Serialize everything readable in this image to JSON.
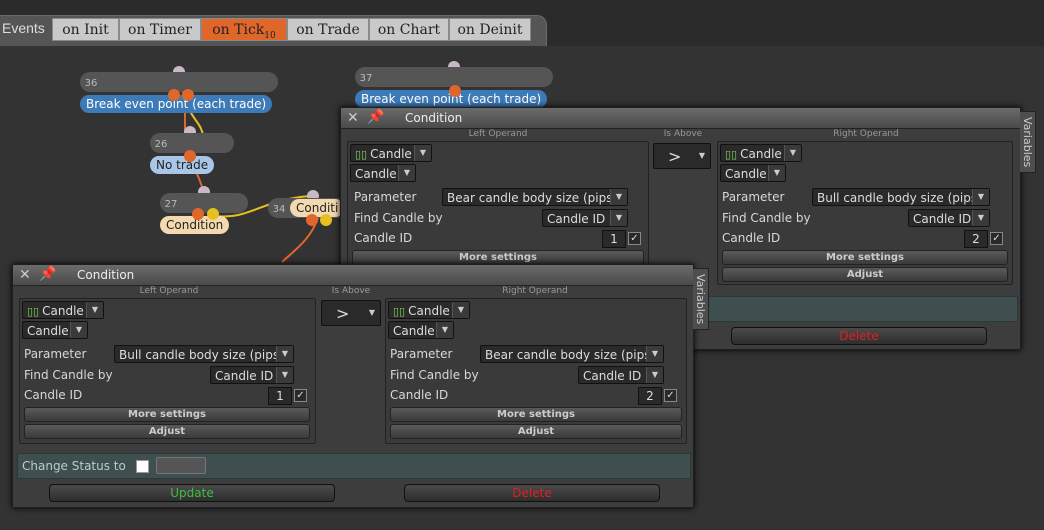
{
  "events_label": "Events",
  "tabs": [
    {
      "label": "on Init"
    },
    {
      "label": "on Timer"
    },
    {
      "label": "on Tick",
      "badge": "10"
    },
    {
      "label": "on Trade"
    },
    {
      "label": "on Chart"
    },
    {
      "label": "on Deinit"
    }
  ],
  "nodes": [
    {
      "num": "36",
      "label": "Break even point (each trade)"
    },
    {
      "num": "37",
      "label": "Break even point (each trade)"
    },
    {
      "num": "26",
      "label": "No trade"
    },
    {
      "num": "27",
      "label": "Condition"
    },
    {
      "num": "34",
      "label": "Conditi"
    }
  ],
  "panel_back": {
    "title": "Condition",
    "variables": "Variables",
    "left_header": "Left Operand",
    "mid_header": "Is Above",
    "right_header": "Right Operand",
    "operator": ">",
    "left": {
      "type": "Candle",
      "sub": "Candle",
      "parameter_label": "Parameter",
      "parameter": "Bear candle body size (pips)",
      "find_label": "Find Candle by",
      "find": "Candle ID",
      "id_label": "Candle ID",
      "id": "1",
      "more": "More settings"
    },
    "right": {
      "type": "Candle",
      "sub": "Candle",
      "parameter_label": "Parameter",
      "parameter": "Bull candle body size (pips)",
      "find_label": "Find Candle by",
      "find": "Candle ID",
      "id_label": "Candle ID",
      "id": "2",
      "more": "More settings",
      "adjust": "Adjust"
    },
    "delete": "Delete"
  },
  "panel_front": {
    "title": "Condition",
    "variables": "Variables",
    "left_header": "Left Operand",
    "mid_header": "Is Above",
    "right_header": "Right Operand",
    "operator": ">",
    "left": {
      "type": "Candle",
      "sub": "Candle",
      "parameter_label": "Parameter",
      "parameter": "Bull candle body size (pips)",
      "find_label": "Find Candle by",
      "find": "Candle ID",
      "id_label": "Candle ID",
      "id": "1",
      "more": "More settings",
      "adjust": "Adjust"
    },
    "right": {
      "type": "Candle",
      "sub": "Candle",
      "parameter_label": "Parameter",
      "parameter": "Bear candle body size (pips)",
      "find_label": "Find Candle by",
      "find": "Candle ID",
      "id_label": "Candle ID",
      "id": "2",
      "more": "More settings",
      "adjust": "Adjust"
    },
    "status_label": "Change Status to",
    "update": "Update",
    "delete": "Delete"
  },
  "colors": {
    "active_tab": "#e0662a",
    "update": "#3fbf3f",
    "delete": "#e02020",
    "node_blue": "#3d7ab8",
    "node_orange": "#e0662a",
    "node_yellow": "#e5c020"
  }
}
